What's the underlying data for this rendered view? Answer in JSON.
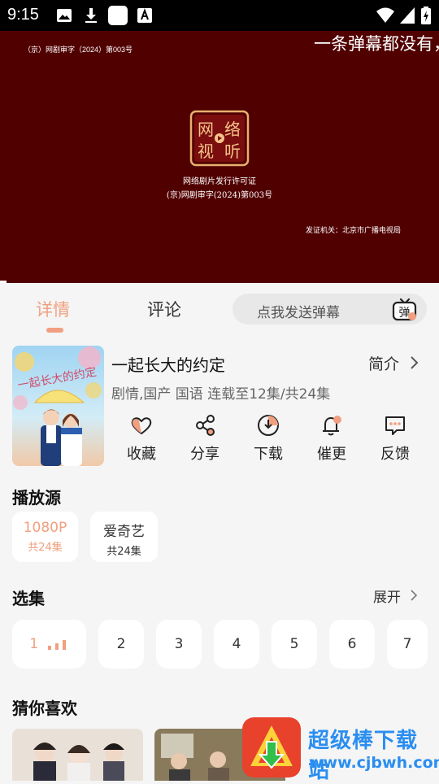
{
  "status_bar": {
    "time": "9:15"
  },
  "player": {
    "license_top": "（京）网剧审字（2024）第003号",
    "danmaku": "一条弹幕都没有，",
    "seal_text": "网络视听",
    "cert_line1": "网络剧片发行许可证",
    "cert_line2": "(京)网剧审字(2024)第003号",
    "issuer": "发证机关：北京市广播电视局"
  },
  "tabs": [
    {
      "label": "详情",
      "active": true
    },
    {
      "label": "评论",
      "active": false
    }
  ],
  "danmaku_input": {
    "placeholder": "点我发送弹幕",
    "button_label": "弹"
  },
  "show": {
    "title": "一起长大的约定",
    "intro_label": "简介",
    "meta": "剧情,国产 国语 连载至12集/共24集",
    "poster_caption": "一起长大的约定"
  },
  "actions": [
    {
      "label": "收藏",
      "icon": "heart-icon"
    },
    {
      "label": "分享",
      "icon": "share-icon"
    },
    {
      "label": "下载",
      "icon": "download-icon"
    },
    {
      "label": "催更",
      "icon": "bell-icon"
    },
    {
      "label": "反馈",
      "icon": "feedback-icon"
    }
  ],
  "sources": {
    "title": "播放源",
    "items": [
      {
        "name": "1080P",
        "count": "共24集",
        "selected": true
      },
      {
        "name": "爱奇艺",
        "count": "共24集",
        "selected": false
      }
    ]
  },
  "episodes": {
    "title": "选集",
    "expand_label": "展开",
    "items": [
      "1",
      "2",
      "3",
      "4",
      "5",
      "6",
      "7"
    ],
    "playing": "1"
  },
  "recommend": {
    "title": "猜你喜欢"
  },
  "watermark": {
    "name": "超级棒下载站",
    "url": "www.cjbwh.com"
  },
  "colors": {
    "accent": "#f0a080",
    "player_bg": "#510000",
    "watermark": "#2a8ef0"
  }
}
